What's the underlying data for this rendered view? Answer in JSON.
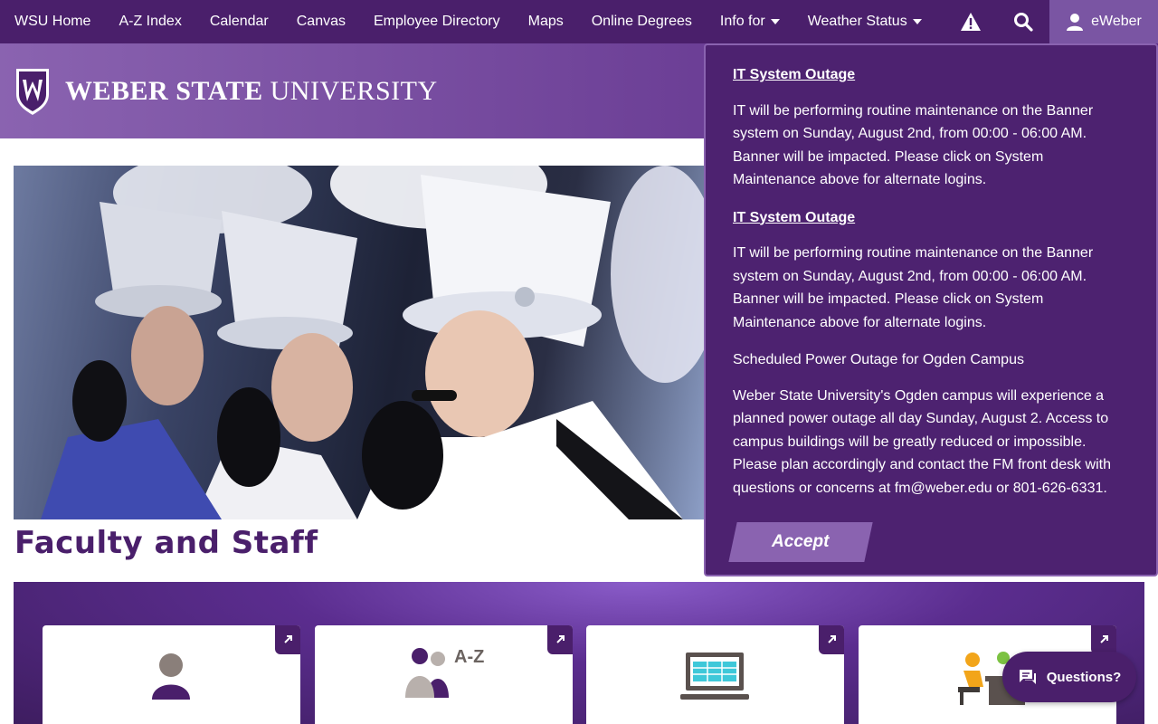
{
  "nav": {
    "links": [
      "WSU Home",
      "A-Z Index",
      "Calendar",
      "Canvas",
      "Employee Directory",
      "Maps",
      "Online Degrees"
    ],
    "info_for": "Info for",
    "weather_status": "Weather Status",
    "alert_icon": "alert-triangle-icon",
    "search_icon": "search-icon",
    "account_label": "eWeber"
  },
  "brand": {
    "name_bold": "WEBER STATE",
    "name_regular": "UNIVERSITY",
    "primary_color": "#4a1f6b",
    "accent_color": "#8a63b0"
  },
  "page": {
    "title": "Faculty and Staff"
  },
  "tiles": {
    "az_label": "A-Z"
  },
  "alerts": {
    "items": [
      {
        "title": "IT System Outage",
        "body": "IT will be performing routine maintenance on the Banner system on Sunday, August 2nd, from 00:00 - 06:00 AM. Banner will be impacted. Please click on System Maintenance above for alternate logins."
      },
      {
        "title": "IT System Outage",
        "body": "IT will be performing routine maintenance on the Banner system on Sunday, August 2nd, from 00:00 - 06:00 AM. Banner will be impacted. Please click on System Maintenance above for alternate logins."
      },
      {
        "title": "Scheduled Power Outage for Ogden Campus",
        "body": "Weber State University's Ogden campus will experience a planned power outage all day Sunday, August 2. Access to campus buildings will be greatly reduced or impossible. Please plan accordingly and contact the FM front desk with questions or concerns at fm@weber.edu or 801-626-6331."
      }
    ],
    "accept_label": "Accept"
  },
  "chat": {
    "label": "Questions?"
  }
}
